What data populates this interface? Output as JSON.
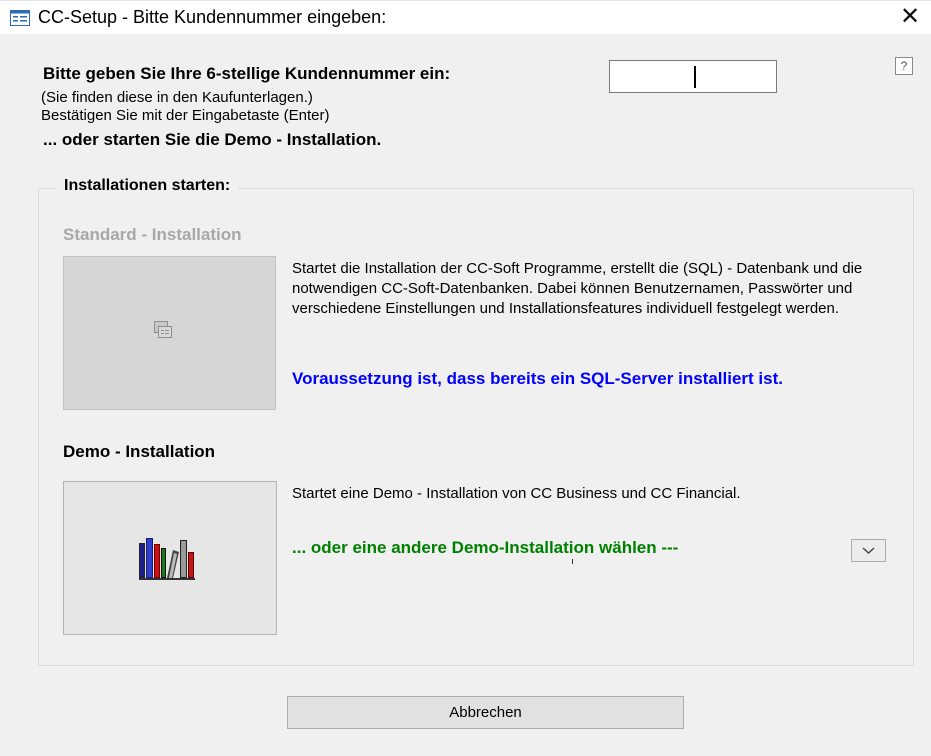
{
  "window": {
    "title": "CC-Setup - Bitte Kundennummer eingeben:",
    "close_glyph": "✕",
    "app_icon": "form-icon"
  },
  "help": {
    "glyph": "?"
  },
  "customer": {
    "prompt": "Bitte geben Sie Ihre 6-stellige Kundennummer ein:",
    "info_line1": "(Sie finden diese in den Kaufunterlagen.)",
    "info_line2": "Bestätigen Sie mit der Eingabetaste (Enter)",
    "demo_hint": "... oder starten Sie die Demo - Installation.",
    "input_value": ""
  },
  "installations": {
    "group_label": "Installationen starten:",
    "standard": {
      "title": "Standard - Installation",
      "description": "Startet die Installation der CC-Soft Programme, erstellt die (SQL) - Datenbank und die notwendigen CC-Soft-Datenbanken. Dabei können Benutzernamen, Passwörter und verschiedene Einstellungen und Installationsfeatures individuell festgelegt werden.",
      "requirement": "Voraussetzung ist, dass bereits ein SQL-Server installiert ist.",
      "icon": "form-icon",
      "enabled": false
    },
    "demo": {
      "title": "Demo - Installation",
      "description": "Startet eine Demo - Installation von CC Business und CC Financial.",
      "other_link": "... oder eine andere Demo-Installation wählen ---",
      "icon": "books-icon"
    }
  },
  "buttons": {
    "cancel": "Abbrechen"
  },
  "colors": {
    "requirement_text": "#0000ff",
    "demo_link_text": "#008000",
    "disabled_title": "#a8a8a8"
  }
}
